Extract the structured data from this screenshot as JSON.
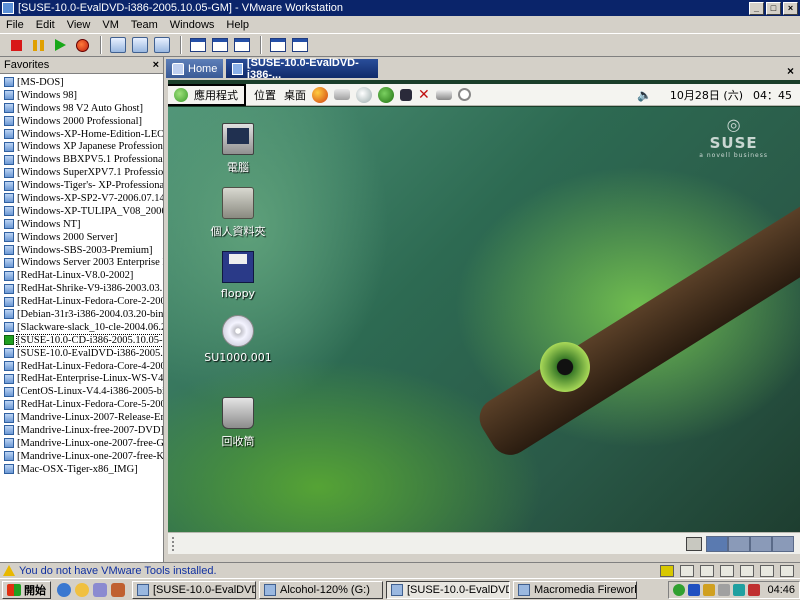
{
  "window": {
    "title": "[SUSE-10.0-EvalDVD-i386-2005.10.05-GM] - VMware Workstation",
    "controls": {
      "minimize": "_",
      "maximize": "□",
      "close": "×"
    }
  },
  "menu": [
    "File",
    "Edit",
    "View",
    "VM",
    "Team",
    "Windows",
    "Help"
  ],
  "toolbar": {
    "icons": [
      "power-off-icon",
      "suspend-icon",
      "power-on-icon",
      "reset-icon",
      "snapshot-icon",
      "revert-snapshot-icon",
      "snapshot-manager-icon",
      "quick-switch-icon",
      "full-screen-icon",
      "summary-view-icon",
      "console-view-icon",
      "appliance-view-icon"
    ]
  },
  "favorites": {
    "title": "Favorites",
    "close": "×",
    "selected_index": 19,
    "items": [
      "[MS-DOS]",
      "[Windows 98]",
      "[Windows 98 V2 Auto Ghost]",
      "[Windows 2000 Professional]",
      "[Windows-XP-Home-Edition-LEO]",
      "[Windows XP Japanese Professional]",
      "[Windows BBXPV5.1 Professional]",
      "[Windows SuperXPV7.1 Professional]",
      "[Windows-Tiger's- XP-Professional-20",
      "[Windows-XP-SP2-V7-2006.07.14_IS",
      "[Windows-XP-TULIPA_V08_2006.08",
      "[Windows NT]",
      "[Windows 2000 Server]",
      "[Windows-SBS-2003-Premium]",
      "[Windows Server 2003 Enterprise Edit",
      "[RedHat-Linux-V8.0-2002]",
      "[RedHat-Shrike-V9-i386-2003.03.14-c",
      "[RedHat-Linux-Fedora-Core-2-2004]",
      "[Debian-31r3-i386-2004.03.20-binary",
      "[Slackware-slack_10-cle-2004.06.22-i",
      "[SUSE-10.0-CD-i386-2005.10.05-GM",
      "[SUSE-10.0-EvalDVD-i386-2005.10.0",
      "[RedHat-Linux-Fedora-Core-4-2005]",
      "[RedHat-Enterprise-Linux-WS-V4.0-2",
      "[CentOS-Linux-V4.4-i386-2005-bin1-",
      "[RedHat-Linux-Fedora-Core-5-2006-i",
      "[Mandrive-Linux-2007-Release-Eng-C",
      "[Mandrive-Linux-free-2007-DVD]",
      "[Mandrive-Linux-one-2007-free-Gnor",
      "[Mandrive-Linux-one-2007-free-KDE]",
      "[Mac-OSX-Tiger-x86_IMG]"
    ]
  },
  "tabs": {
    "home": "Home",
    "active": "[SUSE-10.0-EvalDVD-i386-...",
    "close": "×"
  },
  "guest": {
    "panel": {
      "apps": "應用程式",
      "places": "位置",
      "desktop": "桌面",
      "date": "10月28日 (六)",
      "time": "04：45",
      "launcher_icons": [
        "firefox-icon",
        "mail-icon",
        "help-icon",
        "gecko-icon",
        "dialog-icon",
        "close-icon",
        "printer-icon",
        "search-icon"
      ]
    },
    "logo": {
      "mark": "◎",
      "name": "SUSE",
      "sub": "a novell business"
    },
    "desktop_icons": [
      "電腦",
      "個人資料夾",
      "floppy",
      "SU1000.001",
      "回收筒"
    ]
  },
  "status": {
    "message": "You do not have VMware Tools installed."
  },
  "taskbar": {
    "start": "開始",
    "tasks": [
      "[SUSE-10.0-EvalDVD-i3...",
      "Alcohol-120% (G:)",
      "[SUSE-10.0-EvalDVD-i3...",
      "Macromedia Fireworks M..."
    ],
    "active_task_index": 2,
    "clock": "04:46"
  }
}
